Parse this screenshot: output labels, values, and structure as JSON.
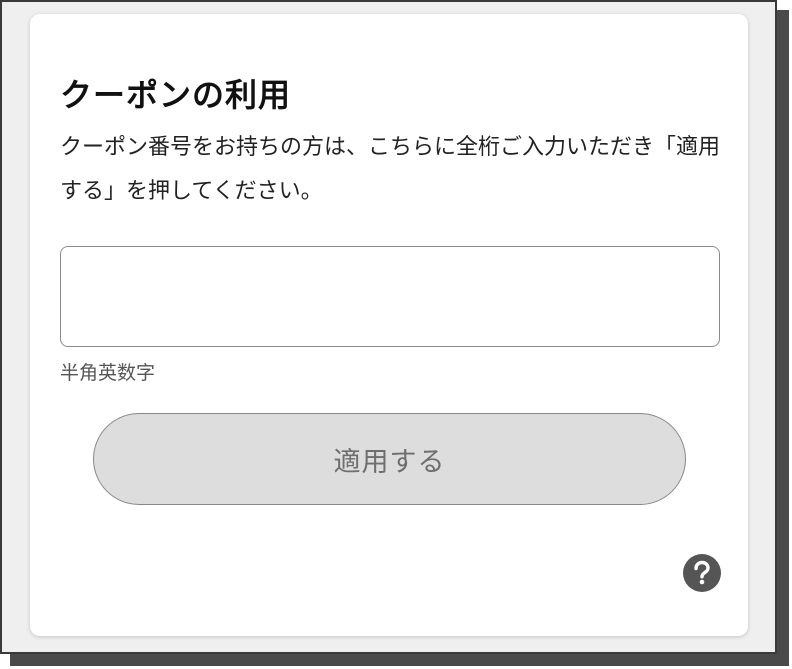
{
  "coupon": {
    "title": "クーポンの利用",
    "description": "クーポン番号をお持ちの方は、こちらに全桁ご入力いただき「適用する」を押してください。",
    "input_value": "",
    "input_placeholder": "",
    "hint": "半角英数字",
    "apply_label": "適用する",
    "help_icon": "question-circle-icon"
  },
  "colors": {
    "button_background": "#dddddd",
    "button_text": "#6e6e6e",
    "help_icon": "#555555"
  }
}
